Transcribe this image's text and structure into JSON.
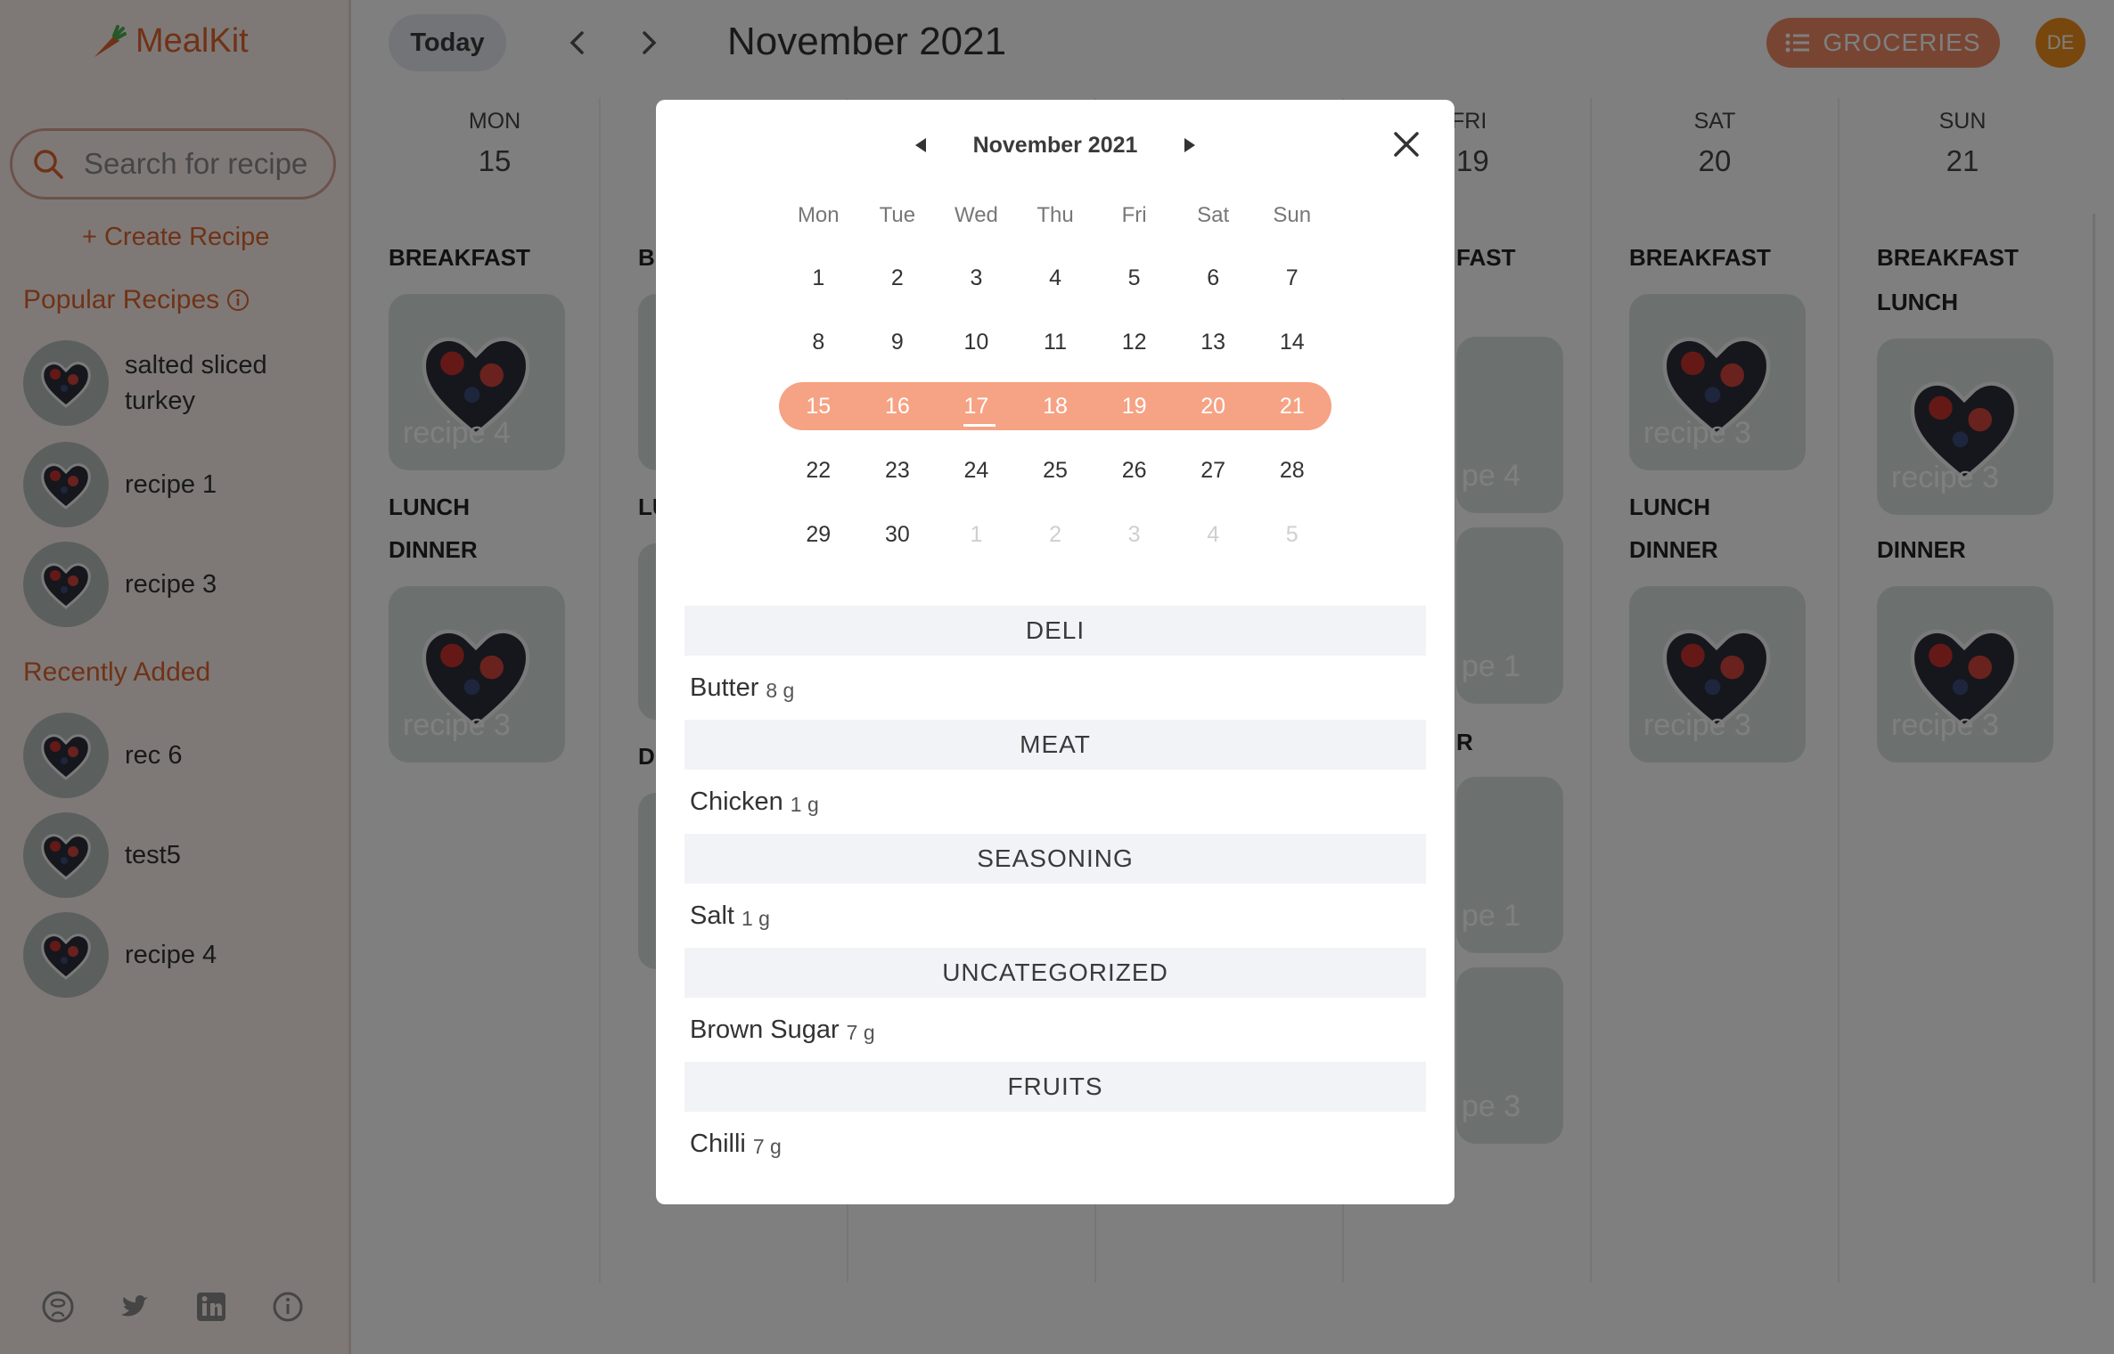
{
  "app": {
    "name": "MealKit"
  },
  "sidebar": {
    "search_placeholder": "Search for recipe",
    "create_label": "+ Create Recipe",
    "popular_title": "Popular Recipes",
    "popular": [
      {
        "name": "salted sliced turkey"
      },
      {
        "name": "recipe 1"
      },
      {
        "name": "recipe 3"
      }
    ],
    "recent_title": "Recently Added",
    "recent": [
      {
        "name": "rec 6"
      },
      {
        "name": "test5"
      },
      {
        "name": "recipe 4"
      }
    ],
    "footer_icons": [
      "github-icon",
      "twitter-icon",
      "linkedin-icon",
      "info-icon"
    ]
  },
  "topbar": {
    "today_label": "Today",
    "month_title": "November 2021",
    "groceries_label": "GROCERIES",
    "avatar_initials": "DE"
  },
  "week": [
    {
      "day": "MON",
      "num": "15",
      "breakfast_label": "BREAKFAST",
      "lunch_label": "LUNCH",
      "dinner_label": "DINNER",
      "breakfast_card": "recipe 4",
      "dinner_card": "recipe 3"
    },
    {
      "day": "SAT",
      "num": "20",
      "breakfast_label": "BREAKFAST",
      "lunch_label": "LUNCH",
      "dinner_label": "DINNER",
      "breakfast_card": "recipe 3",
      "dinner_card": "recipe 3"
    },
    {
      "day": "SUN",
      "num": "21",
      "breakfast_label": "BREAKFAST",
      "lunch_label": "LUNCH",
      "dinner_label": "DINNER",
      "lunch_card": "recipe 3",
      "dinner_card": "recipe 3"
    }
  ],
  "partial_columns": {
    "col2_text": [
      "BR",
      "LU",
      "D"
    ],
    "col5_day": "FRI",
    "col5_num": "19",
    "col5_breakfast_fragment": "FAST",
    "col5_dinner_fragment": "R",
    "col5_cards": [
      "pe 4",
      "pe 1",
      "pe 1",
      "pe 3"
    ]
  },
  "modal": {
    "calendar_title": "November 2021",
    "weekday_headers": [
      "Mon",
      "Tue",
      "Wed",
      "Thu",
      "Fri",
      "Sat",
      "Sun"
    ],
    "weeks": [
      [
        "1",
        "2",
        "3",
        "4",
        "5",
        "6",
        "7"
      ],
      [
        "8",
        "9",
        "10",
        "11",
        "12",
        "13",
        "14"
      ],
      [
        "15",
        "16",
        "17",
        "18",
        "19",
        "20",
        "21"
      ],
      [
        "22",
        "23",
        "24",
        "25",
        "26",
        "27",
        "28"
      ],
      [
        "29",
        "30",
        "1",
        "2",
        "3",
        "4",
        "5"
      ]
    ],
    "selected_week_index": 2,
    "today_date": "17",
    "groceries": [
      {
        "category": "DELI",
        "items": [
          {
            "name": "Butter",
            "qty": "8 g"
          }
        ]
      },
      {
        "category": "MEAT",
        "items": [
          {
            "name": "Chicken",
            "qty": "1 g"
          }
        ]
      },
      {
        "category": "SEASONING",
        "items": [
          {
            "name": "Salt",
            "qty": "1 g"
          }
        ]
      },
      {
        "category": "UNCATEGORIZED",
        "items": [
          {
            "name": "Brown Sugar",
            "qty": "7 g"
          }
        ]
      },
      {
        "category": "FRUITS",
        "items": [
          {
            "name": "Chilli",
            "qty": "7 g"
          }
        ]
      }
    ]
  },
  "colors": {
    "brand": "#e0652e",
    "accent": "#f08b66",
    "week_highlight": "#f5a384",
    "avatar": "#f08f1a",
    "overlay": "rgba(0,0,0,0.5)"
  }
}
